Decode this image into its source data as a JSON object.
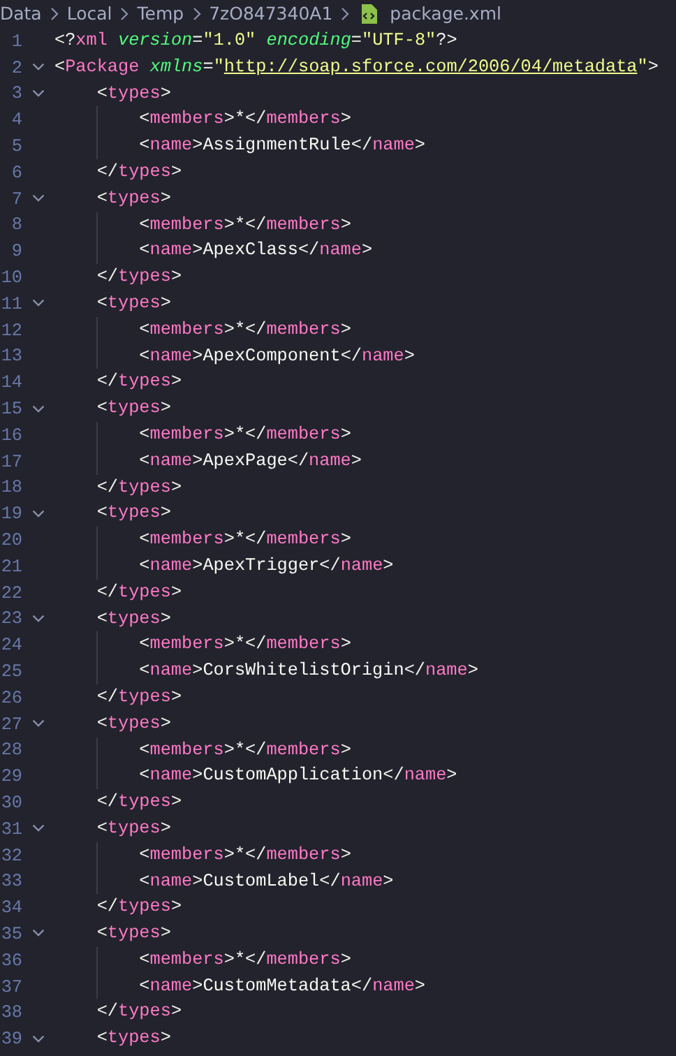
{
  "breadcrumb": [
    "Data",
    "Local",
    "Temp",
    "7zO847340A1",
    "package.xml"
  ],
  "lines": [
    {
      "number": "1",
      "foldable": false,
      "tokens": [
        {
          "kind": "punct",
          "text": "<?"
        },
        {
          "kind": "tag",
          "text": "xml"
        },
        {
          "kind": "attr",
          "text": "version"
        },
        {
          "kind": "punct",
          "text": "="
        },
        {
          "kind": "string",
          "text": "\"1.0\""
        },
        {
          "kind": "attr",
          "text": "encoding"
        },
        {
          "kind": "punct",
          "text": "="
        },
        {
          "kind": "string",
          "text": "\"UTF-8\""
        },
        {
          "kind": "punct",
          "text": "?>"
        }
      ]
    },
    {
      "number": "2",
      "foldable": true,
      "tokens": [
        {
          "kind": "punct",
          "text": "<"
        },
        {
          "kind": "tag",
          "text": "Package"
        },
        {
          "kind": "attr",
          "text": "xmlns"
        },
        {
          "kind": "punct",
          "text": "="
        },
        {
          "kind": "string",
          "text": "\""
        },
        {
          "kind": "link",
          "text": "http://soap.sforce.com/2006/04/metadata"
        },
        {
          "kind": "string",
          "text": "\""
        },
        {
          "kind": "punct",
          "text": ">"
        }
      ],
      "children": [
        {
          "number": "3",
          "foldable": true,
          "tokens": [
            {
              "kind": "punct",
              "text": "<"
            },
            {
              "kind": "tag",
              "text": "types"
            },
            {
              "kind": "punct",
              "text": ">"
            }
          ],
          "children": [
            {
              "number": "4",
              "foldable": false,
              "tokens": [
                {
                  "kind": "punct",
                  "text": "<"
                },
                {
                  "kind": "tag",
                  "text": "members"
                },
                {
                  "kind": "punct",
                  "text": ">"
                },
                {
                  "kind": "text",
                  "text": "*"
                },
                {
                  "kind": "punct",
                  "text": "</"
                },
                {
                  "kind": "tag",
                  "text": "members"
                },
                {
                  "kind": "punct",
                  "text": ">"
                }
              ]
            },
            {
              "number": "5",
              "foldable": false,
              "tokens": [
                {
                  "kind": "punct",
                  "text": "<"
                },
                {
                  "kind": "tag",
                  "text": "name"
                },
                {
                  "kind": "punct",
                  "text": ">"
                },
                {
                  "kind": "text",
                  "text": "AssignmentRule"
                },
                {
                  "kind": "punct",
                  "text": "</"
                },
                {
                  "kind": "tag",
                  "text": "name"
                },
                {
                  "kind": "punct",
                  "text": ">"
                }
              ]
            }
          ]
        },
        {
          "number": "6",
          "foldable": false,
          "tokens": [
            {
              "kind": "punct",
              "text": "</"
            },
            {
              "kind": "tag",
              "text": "types"
            },
            {
              "kind": "punct",
              "text": ">"
            }
          ]
        },
        {
          "number": "7",
          "foldable": true,
          "tokens": [
            {
              "kind": "punct",
              "text": "<"
            },
            {
              "kind": "tag",
              "text": "types"
            },
            {
              "kind": "punct",
              "text": ">"
            }
          ],
          "children": [
            {
              "number": "8",
              "foldable": false,
              "tokens": [
                {
                  "kind": "punct",
                  "text": "<"
                },
                {
                  "kind": "tag",
                  "text": "members"
                },
                {
                  "kind": "punct",
                  "text": ">"
                },
                {
                  "kind": "text",
                  "text": "*"
                },
                {
                  "kind": "punct",
                  "text": "</"
                },
                {
                  "kind": "tag",
                  "text": "members"
                },
                {
                  "kind": "punct",
                  "text": ">"
                }
              ]
            },
            {
              "number": "9",
              "foldable": false,
              "tokens": [
                {
                  "kind": "punct",
                  "text": "<"
                },
                {
                  "kind": "tag",
                  "text": "name"
                },
                {
                  "kind": "punct",
                  "text": ">"
                },
                {
                  "kind": "text",
                  "text": "ApexClass"
                },
                {
                  "kind": "punct",
                  "text": "</"
                },
                {
                  "kind": "tag",
                  "text": "name"
                },
                {
                  "kind": "punct",
                  "text": ">"
                }
              ]
            }
          ]
        },
        {
          "number": "10",
          "foldable": false,
          "tokens": [
            {
              "kind": "punct",
              "text": "</"
            },
            {
              "kind": "tag",
              "text": "types"
            },
            {
              "kind": "punct",
              "text": ">"
            }
          ]
        },
        {
          "number": "11",
          "foldable": true,
          "tokens": [
            {
              "kind": "punct",
              "text": "<"
            },
            {
              "kind": "tag",
              "text": "types"
            },
            {
              "kind": "punct",
              "text": ">"
            }
          ],
          "children": [
            {
              "number": "12",
              "foldable": false,
              "tokens": [
                {
                  "kind": "punct",
                  "text": "<"
                },
                {
                  "kind": "tag",
                  "text": "members"
                },
                {
                  "kind": "punct",
                  "text": ">"
                },
                {
                  "kind": "text",
                  "text": "*"
                },
                {
                  "kind": "punct",
                  "text": "</"
                },
                {
                  "kind": "tag",
                  "text": "members"
                },
                {
                  "kind": "punct",
                  "text": ">"
                }
              ]
            },
            {
              "number": "13",
              "foldable": false,
              "tokens": [
                {
                  "kind": "punct",
                  "text": "<"
                },
                {
                  "kind": "tag",
                  "text": "name"
                },
                {
                  "kind": "punct",
                  "text": ">"
                },
                {
                  "kind": "text",
                  "text": "ApexComponent"
                },
                {
                  "kind": "punct",
                  "text": "</"
                },
                {
                  "kind": "tag",
                  "text": "name"
                },
                {
                  "kind": "punct",
                  "text": ">"
                }
              ]
            }
          ]
        },
        {
          "number": "14",
          "foldable": false,
          "tokens": [
            {
              "kind": "punct",
              "text": "</"
            },
            {
              "kind": "tag",
              "text": "types"
            },
            {
              "kind": "punct",
              "text": ">"
            }
          ]
        },
        {
          "number": "15",
          "foldable": true,
          "tokens": [
            {
              "kind": "punct",
              "text": "<"
            },
            {
              "kind": "tag",
              "text": "types"
            },
            {
              "kind": "punct",
              "text": ">"
            }
          ],
          "children": [
            {
              "number": "16",
              "foldable": false,
              "tokens": [
                {
                  "kind": "punct",
                  "text": "<"
                },
                {
                  "kind": "tag",
                  "text": "members"
                },
                {
                  "kind": "punct",
                  "text": ">"
                },
                {
                  "kind": "text",
                  "text": "*"
                },
                {
                  "kind": "punct",
                  "text": "</"
                },
                {
                  "kind": "tag",
                  "text": "members"
                },
                {
                  "kind": "punct",
                  "text": ">"
                }
              ]
            },
            {
              "number": "17",
              "foldable": false,
              "tokens": [
                {
                  "kind": "punct",
                  "text": "<"
                },
                {
                  "kind": "tag",
                  "text": "name"
                },
                {
                  "kind": "punct",
                  "text": ">"
                },
                {
                  "kind": "text",
                  "text": "ApexPage"
                },
                {
                  "kind": "punct",
                  "text": "</"
                },
                {
                  "kind": "tag",
                  "text": "name"
                },
                {
                  "kind": "punct",
                  "text": ">"
                }
              ]
            }
          ]
        },
        {
          "number": "18",
          "foldable": false,
          "tokens": [
            {
              "kind": "punct",
              "text": "</"
            },
            {
              "kind": "tag",
              "text": "types"
            },
            {
              "kind": "punct",
              "text": ">"
            }
          ]
        },
        {
          "number": "19",
          "foldable": true,
          "tokens": [
            {
              "kind": "punct",
              "text": "<"
            },
            {
              "kind": "tag",
              "text": "types"
            },
            {
              "kind": "punct",
              "text": ">"
            }
          ],
          "children": [
            {
              "number": "20",
              "foldable": false,
              "tokens": [
                {
                  "kind": "punct",
                  "text": "<"
                },
                {
                  "kind": "tag",
                  "text": "members"
                },
                {
                  "kind": "punct",
                  "text": ">"
                },
                {
                  "kind": "text",
                  "text": "*"
                },
                {
                  "kind": "punct",
                  "text": "</"
                },
                {
                  "kind": "tag",
                  "text": "members"
                },
                {
                  "kind": "punct",
                  "text": ">"
                }
              ]
            },
            {
              "number": "21",
              "foldable": false,
              "tokens": [
                {
                  "kind": "punct",
                  "text": "<"
                },
                {
                  "kind": "tag",
                  "text": "name"
                },
                {
                  "kind": "punct",
                  "text": ">"
                },
                {
                  "kind": "text",
                  "text": "ApexTrigger"
                },
                {
                  "kind": "punct",
                  "text": "</"
                },
                {
                  "kind": "tag",
                  "text": "name"
                },
                {
                  "kind": "punct",
                  "text": ">"
                }
              ]
            }
          ]
        },
        {
          "number": "22",
          "foldable": false,
          "tokens": [
            {
              "kind": "punct",
              "text": "</"
            },
            {
              "kind": "tag",
              "text": "types"
            },
            {
              "kind": "punct",
              "text": ">"
            }
          ]
        },
        {
          "number": "23",
          "foldable": true,
          "tokens": [
            {
              "kind": "punct",
              "text": "<"
            },
            {
              "kind": "tag",
              "text": "types"
            },
            {
              "kind": "punct",
              "text": ">"
            }
          ],
          "children": [
            {
              "number": "24",
              "foldable": false,
              "tokens": [
                {
                  "kind": "punct",
                  "text": "<"
                },
                {
                  "kind": "tag",
                  "text": "members"
                },
                {
                  "kind": "punct",
                  "text": ">"
                },
                {
                  "kind": "text",
                  "text": "*"
                },
                {
                  "kind": "punct",
                  "text": "</"
                },
                {
                  "kind": "tag",
                  "text": "members"
                },
                {
                  "kind": "punct",
                  "text": ">"
                }
              ]
            },
            {
              "number": "25",
              "foldable": false,
              "tokens": [
                {
                  "kind": "punct",
                  "text": "<"
                },
                {
                  "kind": "tag",
                  "text": "name"
                },
                {
                  "kind": "punct",
                  "text": ">"
                },
                {
                  "kind": "text",
                  "text": "CorsWhitelistOrigin"
                },
                {
                  "kind": "punct",
                  "text": "</"
                },
                {
                  "kind": "tag",
                  "text": "name"
                },
                {
                  "kind": "punct",
                  "text": ">"
                }
              ]
            }
          ]
        },
        {
          "number": "26",
          "foldable": false,
          "tokens": [
            {
              "kind": "punct",
              "text": "</"
            },
            {
              "kind": "tag",
              "text": "types"
            },
            {
              "kind": "punct",
              "text": ">"
            }
          ]
        },
        {
          "number": "27",
          "foldable": true,
          "tokens": [
            {
              "kind": "punct",
              "text": "<"
            },
            {
              "kind": "tag",
              "text": "types"
            },
            {
              "kind": "punct",
              "text": ">"
            }
          ],
          "children": [
            {
              "number": "28",
              "foldable": false,
              "tokens": [
                {
                  "kind": "punct",
                  "text": "<"
                },
                {
                  "kind": "tag",
                  "text": "members"
                },
                {
                  "kind": "punct",
                  "text": ">"
                },
                {
                  "kind": "text",
                  "text": "*"
                },
                {
                  "kind": "punct",
                  "text": "</"
                },
                {
                  "kind": "tag",
                  "text": "members"
                },
                {
                  "kind": "punct",
                  "text": ">"
                }
              ]
            },
            {
              "number": "29",
              "foldable": false,
              "tokens": [
                {
                  "kind": "punct",
                  "text": "<"
                },
                {
                  "kind": "tag",
                  "text": "name"
                },
                {
                  "kind": "punct",
                  "text": ">"
                },
                {
                  "kind": "text",
                  "text": "CustomApplication"
                },
                {
                  "kind": "punct",
                  "text": "</"
                },
                {
                  "kind": "tag",
                  "text": "name"
                },
                {
                  "kind": "punct",
                  "text": ">"
                }
              ]
            }
          ]
        },
        {
          "number": "30",
          "foldable": false,
          "tokens": [
            {
              "kind": "punct",
              "text": "</"
            },
            {
              "kind": "tag",
              "text": "types"
            },
            {
              "kind": "punct",
              "text": ">"
            }
          ]
        },
        {
          "number": "31",
          "foldable": true,
          "tokens": [
            {
              "kind": "punct",
              "text": "<"
            },
            {
              "kind": "tag",
              "text": "types"
            },
            {
              "kind": "punct",
              "text": ">"
            }
          ],
          "children": [
            {
              "number": "32",
              "foldable": false,
              "tokens": [
                {
                  "kind": "punct",
                  "text": "<"
                },
                {
                  "kind": "tag",
                  "text": "members"
                },
                {
                  "kind": "punct",
                  "text": ">"
                },
                {
                  "kind": "text",
                  "text": "*"
                },
                {
                  "kind": "punct",
                  "text": "</"
                },
                {
                  "kind": "tag",
                  "text": "members"
                },
                {
                  "kind": "punct",
                  "text": ">"
                }
              ]
            },
            {
              "number": "33",
              "foldable": false,
              "tokens": [
                {
                  "kind": "punct",
                  "text": "<"
                },
                {
                  "kind": "tag",
                  "text": "name"
                },
                {
                  "kind": "punct",
                  "text": ">"
                },
                {
                  "kind": "text",
                  "text": "CustomLabel"
                },
                {
                  "kind": "punct",
                  "text": "</"
                },
                {
                  "kind": "tag",
                  "text": "name"
                },
                {
                  "kind": "punct",
                  "text": ">"
                }
              ]
            }
          ]
        },
        {
          "number": "34",
          "foldable": false,
          "tokens": [
            {
              "kind": "punct",
              "text": "</"
            },
            {
              "kind": "tag",
              "text": "types"
            },
            {
              "kind": "punct",
              "text": ">"
            }
          ]
        },
        {
          "number": "35",
          "foldable": true,
          "tokens": [
            {
              "kind": "punct",
              "text": "<"
            },
            {
              "kind": "tag",
              "text": "types"
            },
            {
              "kind": "punct",
              "text": ">"
            }
          ],
          "children": [
            {
              "number": "36",
              "foldable": false,
              "tokens": [
                {
                  "kind": "punct",
                  "text": "<"
                },
                {
                  "kind": "tag",
                  "text": "members"
                },
                {
                  "kind": "punct",
                  "text": ">"
                },
                {
                  "kind": "text",
                  "text": "*"
                },
                {
                  "kind": "punct",
                  "text": "</"
                },
                {
                  "kind": "tag",
                  "text": "members"
                },
                {
                  "kind": "punct",
                  "text": ">"
                }
              ]
            },
            {
              "number": "37",
              "foldable": false,
              "tokens": [
                {
                  "kind": "punct",
                  "text": "<"
                },
                {
                  "kind": "tag",
                  "text": "name"
                },
                {
                  "kind": "punct",
                  "text": ">"
                },
                {
                  "kind": "text",
                  "text": "CustomMetadata"
                },
                {
                  "kind": "punct",
                  "text": "</"
                },
                {
                  "kind": "tag",
                  "text": "name"
                },
                {
                  "kind": "punct",
                  "text": ">"
                }
              ]
            }
          ]
        },
        {
          "number": "38",
          "foldable": false,
          "tokens": [
            {
              "kind": "punct",
              "text": "</"
            },
            {
              "kind": "tag",
              "text": "types"
            },
            {
              "kind": "punct",
              "text": ">"
            }
          ]
        },
        {
          "number": "39",
          "foldable": true,
          "tokens": [
            {
              "kind": "punct",
              "text": "<"
            },
            {
              "kind": "tag",
              "text": "types"
            },
            {
              "kind": "punct",
              "text": ">"
            }
          ]
        }
      ]
    }
  ]
}
